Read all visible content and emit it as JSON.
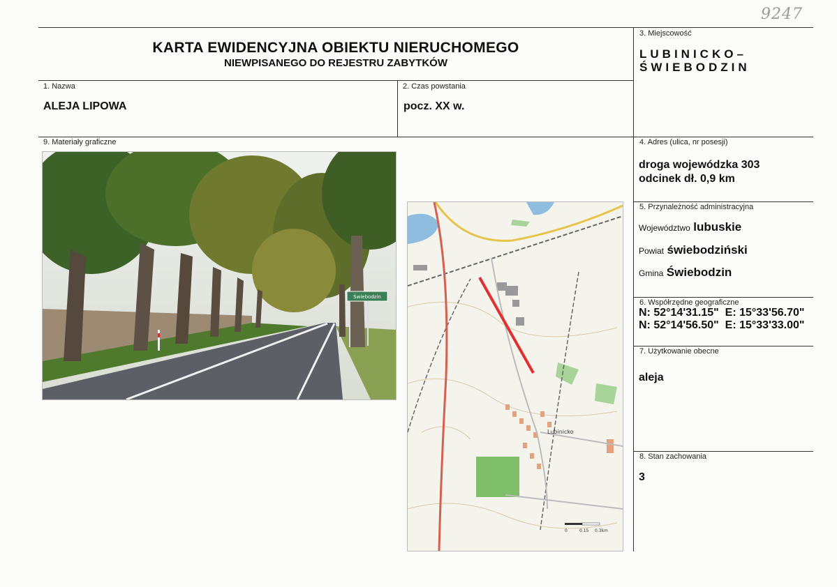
{
  "handwritten_number": "9247",
  "header": {
    "title": "KARTA EWIDENCYJNA OBIEKTU NIERUCHOMEGO",
    "subtitle": "NIEWPISANEGO DO REJESTRU ZABYTKÓW"
  },
  "locality": {
    "label": "3. Miejscowość",
    "value": "LUBINICKO–\nŚWIEBODZIN"
  },
  "name": {
    "label": "1. Nazwa",
    "value": "ALEJA LIPOWA"
  },
  "period": {
    "label": "2. Czas powstania",
    "value": "pocz. XX w."
  },
  "graphics": {
    "label": "9. Materiały graficzne"
  },
  "address": {
    "label": "4. Adres (ulica, nr posesji)",
    "line1": "droga wojewódzka 303",
    "line2": "odcinek dł. 0,9 km"
  },
  "admin": {
    "label": "5. Przynależność administracyjna",
    "voivodeship_label": "Województwo",
    "voivodeship": "lubuskie",
    "county_label": "Powiat",
    "county": "świebodziński",
    "commune_label": "Gmina",
    "commune": "Świebodzin"
  },
  "coords": {
    "label": "6. Współrzędne geograficzne",
    "line1": "N: 52°14'31.15\"  E: 15°33'56.70\"",
    "line2": "N: 52°14'56.50\"  E: 15°33'33.00\""
  },
  "usage": {
    "label": "7. Użytkowanie obecne",
    "value": "aleja"
  },
  "condition": {
    "label": "8. Stan zachowania",
    "value": "3"
  },
  "photo": {
    "sign_text": "Świebodzin"
  },
  "map": {
    "place_label": "Lubinicko",
    "scale_labels": [
      "0",
      "0.15",
      "0.3km"
    ]
  }
}
